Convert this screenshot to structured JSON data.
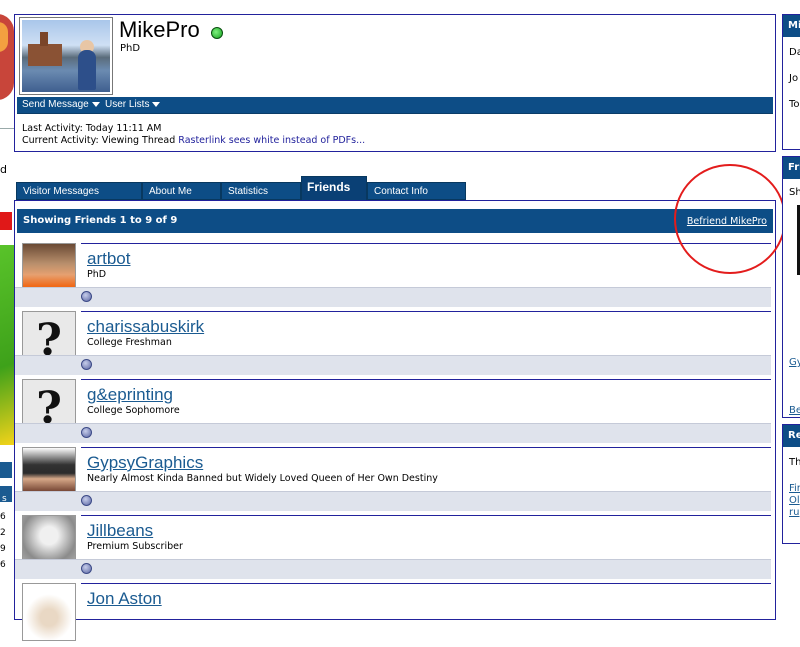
{
  "profile": {
    "username": "MikePro",
    "user_title": "PhD",
    "menu": {
      "send_message": "Send Message",
      "user_lists": "User Lists"
    },
    "activity": {
      "last_label": "Last Activity:",
      "last_value": "Today 11:11 AM",
      "current_label": "Current Activity:",
      "current_prefix": "Viewing Thread",
      "current_link": "Rasterlink sees white instead of PDFs..."
    }
  },
  "tabs": [
    {
      "label": "Visitor Messages"
    },
    {
      "label": "About Me"
    },
    {
      "label": "Statistics"
    },
    {
      "label": "Friends",
      "active": true
    },
    {
      "label": "Contact Info"
    }
  ],
  "friends_section": {
    "title": "Showing Friends 1 to 9 of 9",
    "befriend_label": "Befriend MikePro"
  },
  "friends": [
    {
      "name": "artbot",
      "title": "PhD",
      "avatar": "photo-icon"
    },
    {
      "name": "charissabuskirk",
      "title": "College Freshman",
      "avatar": "question-mark-icon"
    },
    {
      "name": "g&eprinting",
      "title": "College Sophomore",
      "avatar": "question-mark-icon"
    },
    {
      "name": "GypsyGraphics",
      "title": "Nearly Almost Kinda Banned but Widely Loved Queen of Her Own Destiny",
      "avatar": "photo-icon"
    },
    {
      "name": "Jillbeans",
      "title": "Premium Subscriber",
      "avatar": "photo-icon"
    },
    {
      "name": "Jon Aston",
      "title": "",
      "avatar": "photo-icon"
    }
  ],
  "left_edge": {
    "fragment_d": "d",
    "numbers": [
      "6",
      "2",
      "9",
      "6"
    ],
    "nav_label": "s"
  },
  "right_edge": {
    "box1_head": "Mi",
    "box1_lines": [
      "Da",
      "Jo",
      "To"
    ],
    "box2_head": "Fri",
    "box2_text": "Sh",
    "box2_link": "Gy",
    "box2_bottom_link": "Be",
    "box3_head": "Re",
    "box3_text": "Th",
    "box3_links": [
      "Fir",
      "Ol",
      "ru"
    ]
  },
  "colors": {
    "accent_blue": "#0d4d86",
    "border_blue": "#22229c",
    "link_blue": "#1b5b91",
    "annotation_red": "#e31c1c",
    "online_green": "#15a01f"
  }
}
